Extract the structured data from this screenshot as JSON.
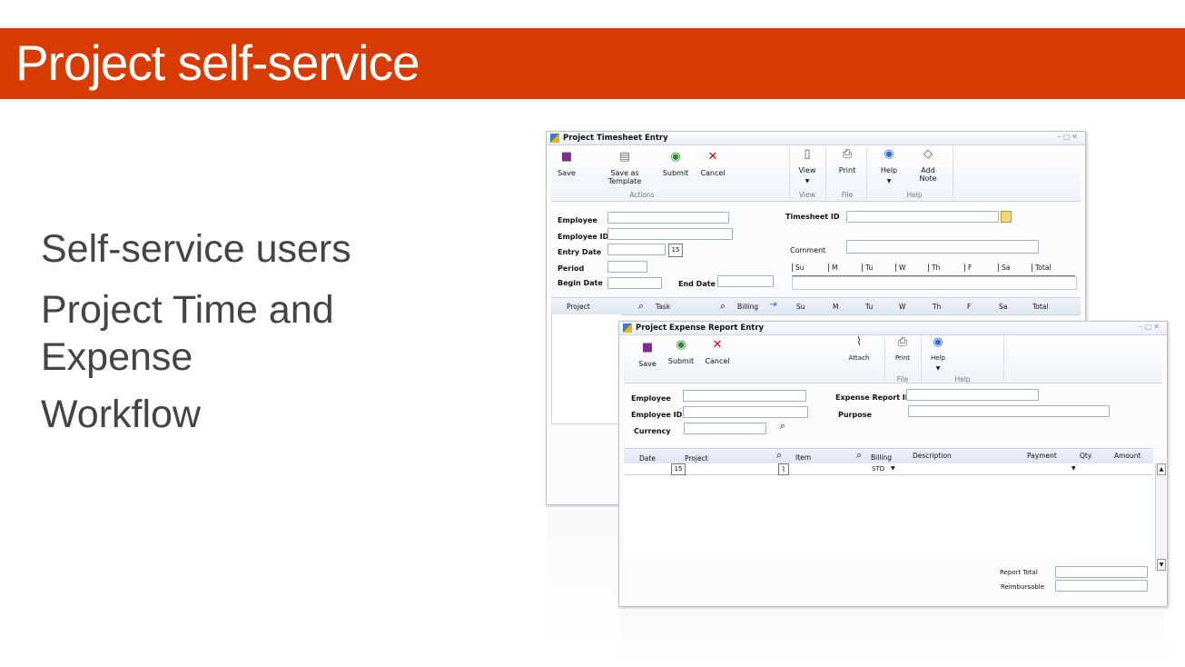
{
  "slide": {
    "title": "Project self-service",
    "bullets": [
      "Self-service users",
      "Project Time and Expense",
      "Workflow"
    ]
  },
  "timesheet": {
    "title": "Project Timesheet Entry",
    "ribbon": {
      "save": "Save",
      "save_template": "Save as Template",
      "submit": "Submit",
      "cancel": "Cancel",
      "view": "View",
      "print": "Print",
      "help": "Help",
      "add_note": "Add Note",
      "groups": {
        "actions": "Actions",
        "view": "View",
        "file": "File",
        "help": "Help"
      }
    },
    "fields": {
      "employee": "Employee",
      "employee_id": "Employee ID",
      "entry_date": "Entry Date",
      "period": "Period",
      "begin_date": "Begin Date",
      "end_date": "End Date",
      "timesheet_id": "Timesheet ID",
      "comment": "Comment",
      "calendar_day": "15"
    },
    "day_headers": [
      "Su",
      "M",
      "Tu",
      "W",
      "Th",
      "F",
      "Sa",
      "Total"
    ],
    "grid_headers": {
      "project": "Project",
      "task": "Task",
      "billing": "Billing",
      "days": [
        "Su",
        "M",
        "Tu",
        "W",
        "Th",
        "F",
        "Sa",
        "Total"
      ]
    }
  },
  "expense": {
    "title": "Project Expense Report Entry",
    "ribbon": {
      "save": "Save",
      "submit": "Submit",
      "cancel": "Cancel",
      "attach": "Attach",
      "print": "Print",
      "help": "Help",
      "groups": {
        "file": "File",
        "help": "Help"
      }
    },
    "fields": {
      "employee": "Employee",
      "employee_id": "Employee ID",
      "currency": "Currency",
      "expense_report_id": "Expense Report ID",
      "purpose": "Purpose"
    },
    "grid_headers": {
      "date": "Date",
      "project": "Project",
      "item": "Item",
      "billing": "Billing",
      "description": "Description",
      "payment": "Payment",
      "qty": "Qty",
      "amount": "Amount"
    },
    "row": {
      "calendar_day": "15",
      "billing_value": "STD"
    },
    "totals": {
      "report_total": "Report Total",
      "reimbursable": "Reimbursable"
    }
  },
  "colors": {
    "accent": "#d83b01",
    "title_text": "#ffffff",
    "bullet_text": "#444444"
  }
}
